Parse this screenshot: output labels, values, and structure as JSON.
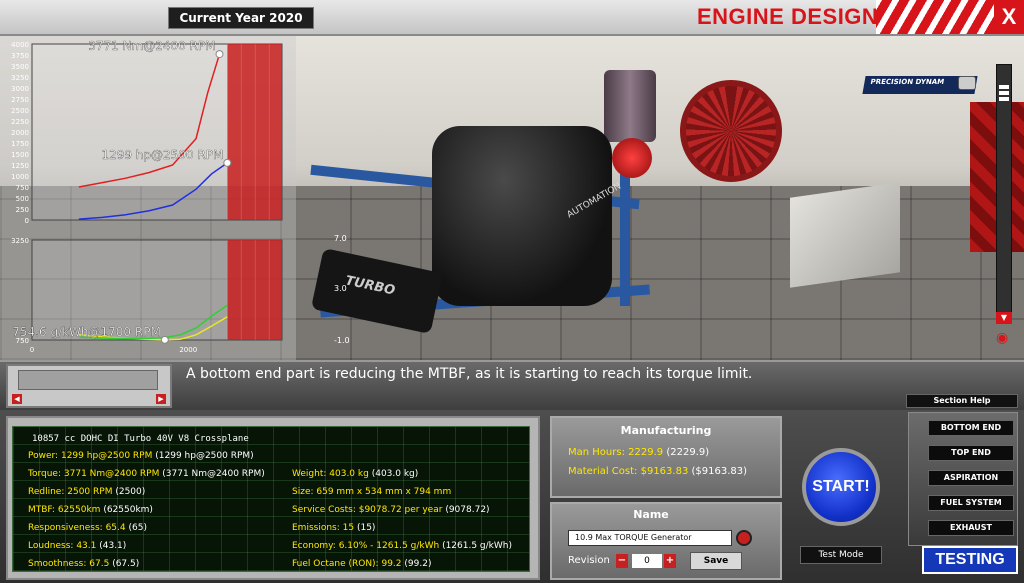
{
  "header": {
    "current_year": "Current Year 2020",
    "title": "ENGINE DESIGN",
    "close_label": "X",
    "sponsor_logo": "PRECISION DYNAM"
  },
  "charts": {
    "torque_label": "3771 Nm@2400 RPM",
    "power_label": "1299 hp@2500 RPM",
    "economy_label": "754.6 g/kWh@1700 RPM",
    "scene_marker_1": "7.0",
    "scene_marker_2": "3.0",
    "scene_marker_3": "-1.0"
  },
  "chart_data": [
    {
      "type": "line",
      "y_ticks": [
        0,
        250,
        500,
        750,
        1000,
        1250,
        1500,
        1750,
        2000,
        2250,
        2500,
        2750,
        3000,
        3250,
        3500,
        3750,
        4000
      ],
      "ylim": [
        0,
        4000
      ],
      "redline_rpm": 2500,
      "series": [
        {
          "color": "#e02020",
          "x": [
            600,
            900,
            1200,
            1500,
            1800,
            2100,
            2250,
            2400
          ],
          "values": [
            750,
            850,
            950,
            1080,
            1250,
            1850,
            2900,
            3771
          ]
        },
        {
          "color": "#2030e0",
          "x": [
            600,
            900,
            1200,
            1500,
            1800,
            2100,
            2300,
            2500
          ],
          "values": [
            20,
            60,
            120,
            210,
            340,
            700,
            1050,
            1299
          ]
        }
      ],
      "markers": [
        {
          "x": 2400,
          "y": 3771,
          "label": "3771 Nm@2400 RPM"
        },
        {
          "x": 2500,
          "y": 1299,
          "label": "1299 hp@2500 RPM"
        }
      ]
    },
    {
      "type": "line",
      "y_ticks": [
        750,
        3250
      ],
      "ylim": [
        750,
        3250
      ],
      "x_ticks": [
        0,
        2000
      ],
      "redline_rpm": 2500,
      "series": [
        {
          "color": "#e8e820",
          "x": [
            600,
            900,
            1200,
            1500,
            1700,
            1900,
            2100,
            2300,
            2500
          ],
          "values": [
            880,
            830,
            790,
            765,
            755,
            770,
            880,
            1100,
            1330
          ]
        },
        {
          "color": "#30d030",
          "x": [
            600,
            900,
            1200,
            1500,
            1700,
            1900,
            2100,
            2300,
            2500
          ],
          "values": [
            820,
            800,
            785,
            790,
            810,
            880,
            1050,
            1350,
            1620
          ]
        }
      ],
      "markers": [
        {
          "x": 1700,
          "y": 754.6,
          "label": "754.6 g/kWh@1700 RPM"
        }
      ]
    }
  ],
  "message": "A bottom end part is reducing the MTBF, as it is starting to reach its torque limit.",
  "stats": {
    "title": "10857 cc DOHC DI Turbo 40V V8 Crossplane",
    "power": {
      "label": "Power:",
      "value": "1299 hp@2500 RPM",
      "prev": "(1299 hp@2500 RPM)"
    },
    "torque": {
      "label": "Torque:",
      "value": "3771 Nm@2400 RPM",
      "prev": "(3771 Nm@2400 RPM)"
    },
    "redline": {
      "label": "Redline:",
      "value": "2500 RPM",
      "prev": "(2500)"
    },
    "mtbf": {
      "label": "MTBF:",
      "value": "62550km",
      "prev": "(62550km)"
    },
    "responsiveness": {
      "label": "Responsiveness:",
      "value": "65.4",
      "prev": "(65)"
    },
    "loudness": {
      "label": "Loudness:",
      "value": "43.1",
      "prev": "(43.1)"
    },
    "smoothness": {
      "label": "Smoothness:",
      "value": "67.5",
      "prev": "(67.5)"
    },
    "weight": {
      "label": "Weight:",
      "value": "403.0 kg",
      "prev": "(403.0 kg)"
    },
    "size": {
      "label": "Size:",
      "value": "659 mm x 534 mm x 794 mm",
      "prev": ""
    },
    "service": {
      "label": "Service Costs:",
      "value": "$9078.72 per year",
      "prev": "(9078.72)"
    },
    "emissions": {
      "label": "Emissions:",
      "value": "15",
      "prev": "(15)"
    },
    "economy": {
      "label": "Economy:",
      "value": "6.10% - 1261.5 g/kWh",
      "prev": "(1261.5 g/kWh)"
    },
    "octane": {
      "label": "Fuel Octane (RON):",
      "value": "99.2",
      "prev": "(99.2)"
    }
  },
  "manufacturing": {
    "title": "Manufacturing",
    "man_hours_label": "Man Hours:",
    "man_hours_value": "2229.9",
    "man_hours_prev": "(2229.9)",
    "material_label": "Material Cost:",
    "material_value": "$9163.83",
    "material_prev": "($9163.83)"
  },
  "name_panel": {
    "title": "Name",
    "engine_name": "10.9 Max TORQUE Generator",
    "revision_label": "Revision",
    "revision_value": "0",
    "save_label": "Save"
  },
  "actions": {
    "start_label": "START!",
    "test_mode_label": "Test Mode",
    "section_help_label": "Section Help",
    "testing_label": "TESTING"
  },
  "nav": [
    "BOTTOM END",
    "TOP END",
    "ASPIRATION",
    "FUEL SYSTEM",
    "EXHAUST"
  ],
  "colors": {
    "accent_red": "#d8141b",
    "stat_label_yellow": "#ffe800",
    "start_blue": "#1130c8"
  }
}
